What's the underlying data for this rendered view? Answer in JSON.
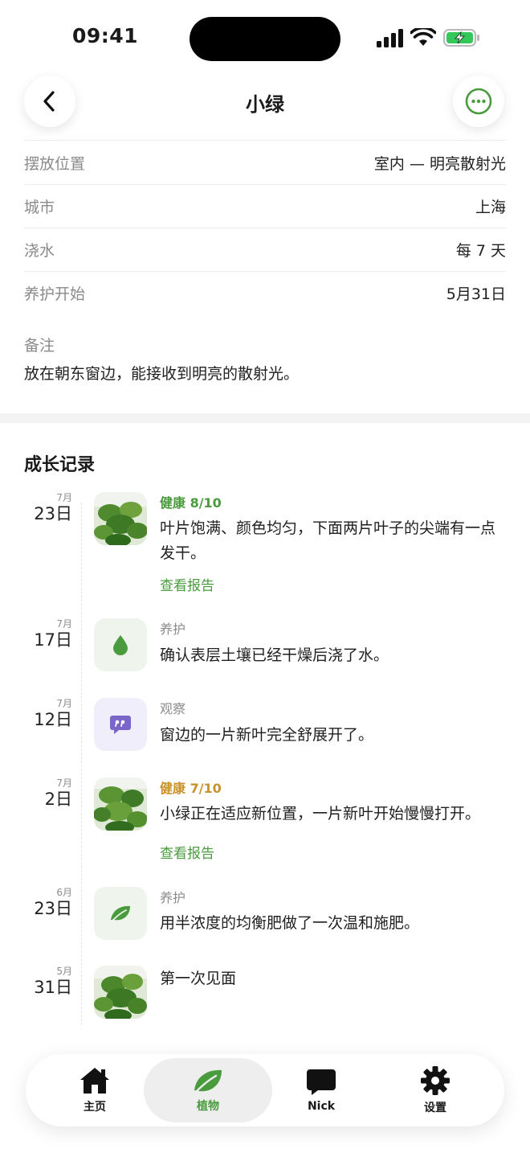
{
  "status_bar": {
    "time": "09:41"
  },
  "header": {
    "title": "小绿"
  },
  "info": [
    {
      "label": "摆放位置",
      "value": "室内 — 明亮散射光"
    },
    {
      "label": "城市",
      "value": "上海"
    },
    {
      "label": "浇水",
      "value": "每 7 天"
    },
    {
      "label": "养护开始",
      "value": "5月31日"
    }
  ],
  "notes": {
    "label": "备注",
    "text": "放在朝东窗边，能接收到明亮的散射光。"
  },
  "growth": {
    "title": "成长记录",
    "entries": [
      {
        "month": "7月",
        "day": "23日",
        "kind": "photo",
        "tag": "健康 8/10",
        "text": "叶片饱满、颜色均匀，下面两片叶子的尖端有一点发干。",
        "link": "查看报告"
      },
      {
        "month": "7月",
        "day": "17日",
        "kind": "water-icon",
        "tag": "养护",
        "text": "确认表层土壤已经干燥后浇了水。"
      },
      {
        "month": "7月",
        "day": "12日",
        "kind": "quote-icon",
        "tag": "观察",
        "text": "窗边的一片新叶完全舒展开了。"
      },
      {
        "month": "7月",
        "day": "2日",
        "kind": "photo",
        "tag": "健康 7/10",
        "text": "小绿正在适应新位置，一片新叶开始慢慢打开。",
        "link": "查看报告"
      },
      {
        "month": "6月",
        "day": "23日",
        "kind": "leaf-icon",
        "tag": "养护",
        "text": "用半浓度的均衡肥做了一次温和施肥。"
      },
      {
        "month": "5月",
        "day": "31日",
        "kind": "photo",
        "tag": "",
        "text": "第一次见面"
      }
    ]
  },
  "tabbar": {
    "tabs": [
      {
        "label": "主页",
        "icon": "home-icon"
      },
      {
        "label": "植物",
        "icon": "leaf-icon",
        "active": true
      },
      {
        "label": "Nick",
        "icon": "chat-bubble-icon"
      },
      {
        "label": "设置",
        "icon": "gear-icon"
      }
    ]
  },
  "colors": {
    "accent": "#4a9b3e",
    "warning": "#c9922a",
    "purple": "#7a65c9"
  }
}
